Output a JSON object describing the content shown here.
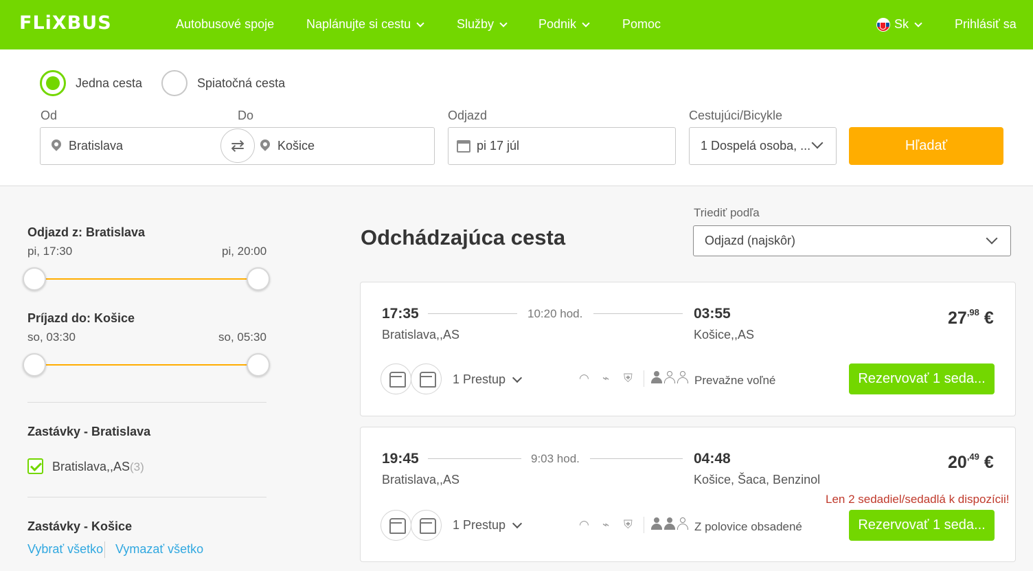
{
  "header": {
    "logo": "FLiXBUS",
    "nav": [
      "Autobusové spoje",
      "Naplánujte si cestu",
      "Služby",
      "Podnik",
      "Pomoc"
    ],
    "language": "Sk",
    "login": "Prihlásiť sa"
  },
  "search": {
    "one_way": "Jedna cesta",
    "round_trip": "Spiatočná cesta",
    "from_label": "Od",
    "from_value": "Bratislava",
    "to_label": "Do",
    "to_value": "Košice",
    "date_label": "Odjazd",
    "date_value": "pi 17 júl",
    "pax_label": "Cestujúci/Bicykle",
    "pax_value": "1 Dospelá osoba, ...",
    "search_button": "Hľadať"
  },
  "filters": {
    "departure_title": "Odjazd z: Bratislava",
    "departure_min": "pi, 17:30",
    "departure_max": "pi, 20:00",
    "arrival_title": "Príjazd do: Košice",
    "arrival_min": "so, 03:30",
    "arrival_max": "so, 05:30",
    "stops_from_title": "Zastávky - Bratislava",
    "stop_from_name": "Bratislava,,AS",
    "stop_from_count": "(3)",
    "stops_to_title": "Zastávky - Košice",
    "select_all": "Vybrať všetko",
    "clear_all": "Vymazať všetko"
  },
  "results": {
    "title": "Odchádzajúca cesta",
    "sort_label": "Triediť podľa",
    "sort_value": "Odjazd (najskôr)",
    "trips": [
      {
        "dep_time": "17:35",
        "dep_station": "Bratislava,,AS",
        "duration": "10:20 hod.",
        "arr_time": "03:55",
        "arr_station": "Košice,,AS",
        "price_main": "27",
        "price_cents": ",98",
        "currency": "€",
        "transfers": "1 Prestup",
        "occupancy": "Prevažne voľné",
        "book": "Rezervovať 1 seda..."
      },
      {
        "dep_time": "19:45",
        "dep_station": "Bratislava,,AS",
        "duration": "9:03 hod.",
        "arr_time": "04:48",
        "arr_station": "Košice, Šaca, Benzinol",
        "price_main": "20",
        "price_cents": ",49",
        "currency": "€",
        "warning": "Len 2 sedadiel/sedadlá k dispozícii!",
        "transfers": "1 Prestup",
        "occupancy": "Z polovice obsadené",
        "book": "Rezervovať 1 seda..."
      }
    ]
  }
}
